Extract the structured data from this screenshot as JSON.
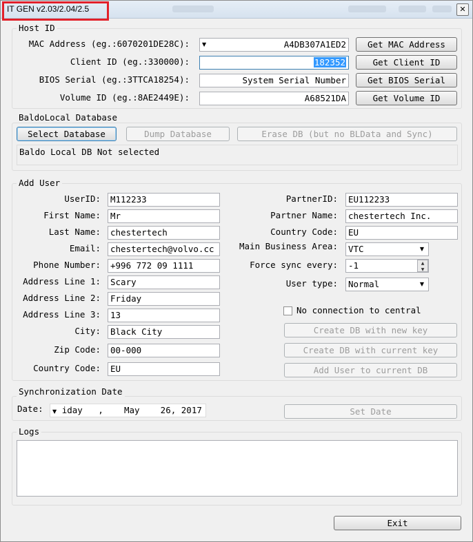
{
  "window": {
    "title": "IT GEN v2.03/2.04/2.5",
    "close_glyph": "✕"
  },
  "host_id": {
    "group_label": "Host ID",
    "mac_label": "MAC Address (eg.:6070201DE28C):",
    "mac_value": "A4DB307A1ED2",
    "get_mac_button": "Get MAC Address",
    "client_label": "Client ID (eg.:330000):",
    "client_value": "182352",
    "get_client_button": "Get Client ID",
    "bios_label": "BIOS Serial (eg.:3TTCA18254):",
    "bios_value": "System Serial Number",
    "get_bios_button": "Get BIOS Serial",
    "volume_label": "Volume ID (eg.:8AE2449E):",
    "volume_value": "A68521DA",
    "get_volume_button": "Get Volume ID"
  },
  "database": {
    "group_label": "BaldoLocal Database",
    "select_button": "Select Database",
    "dump_button": "Dump Database",
    "erase_button": "Erase DB (but no BLData and Sync)",
    "status_text": "Baldo Local DB Not selected"
  },
  "add_user": {
    "group_label": "Add User",
    "userid_label": "UserID:",
    "userid_value": "M112233",
    "first_name_label": "First Name:",
    "first_name_value": "Mr",
    "last_name_label": "Last Name:",
    "last_name_value": "chestertech",
    "email_label": "Email:",
    "email_value": "chestertech@volvo.cc",
    "phone_label": "Phone Number:",
    "phone_value": "+996 772 09 1111",
    "addr1_label": "Address Line 1:",
    "addr1_value": "Scary",
    "addr2_label": "Address Line 2:",
    "addr2_value": "Friday",
    "addr3_label": "Address Line 3:",
    "addr3_value": "13",
    "city_label": "City:",
    "city_value": "Black City",
    "zip_label": "Zip Code:",
    "zip_value": "00-000",
    "country_label": "Country Code:",
    "country_value": "EU",
    "partner_id_label": "PartnerID:",
    "partner_id_value": "EU112233",
    "partner_name_label": "Partner Name:",
    "partner_name_value": "chestertech Inc.",
    "partner_country_label": "Country Code:",
    "partner_country_value": "EU",
    "business_area_label": "Main Business Area:",
    "business_area_value": "VTC",
    "force_sync_label": "Force sync every:",
    "force_sync_value": "-1",
    "user_type_label": "User type:",
    "user_type_value": "Normal",
    "no_connection_label": "No connection to central",
    "no_connection_checked": false,
    "create_new_key_button": "Create DB with new key",
    "create_current_key_button": "Create DB with current key",
    "add_user_button": "Add User to current DB"
  },
  "sync": {
    "group_label": "Synchronization Date",
    "date_label": "Date:",
    "date_value": "iday   ,    May    26, 2017",
    "set_date_button": "Set Date"
  },
  "logs": {
    "group_label": "Logs",
    "content": ""
  },
  "footer": {
    "exit_button": "Exit"
  },
  "icons": {
    "dropdown": "chevron-down-icon",
    "spin_up": "spin-up-icon",
    "spin_down": "spin-down-icon",
    "close": "close-icon"
  }
}
